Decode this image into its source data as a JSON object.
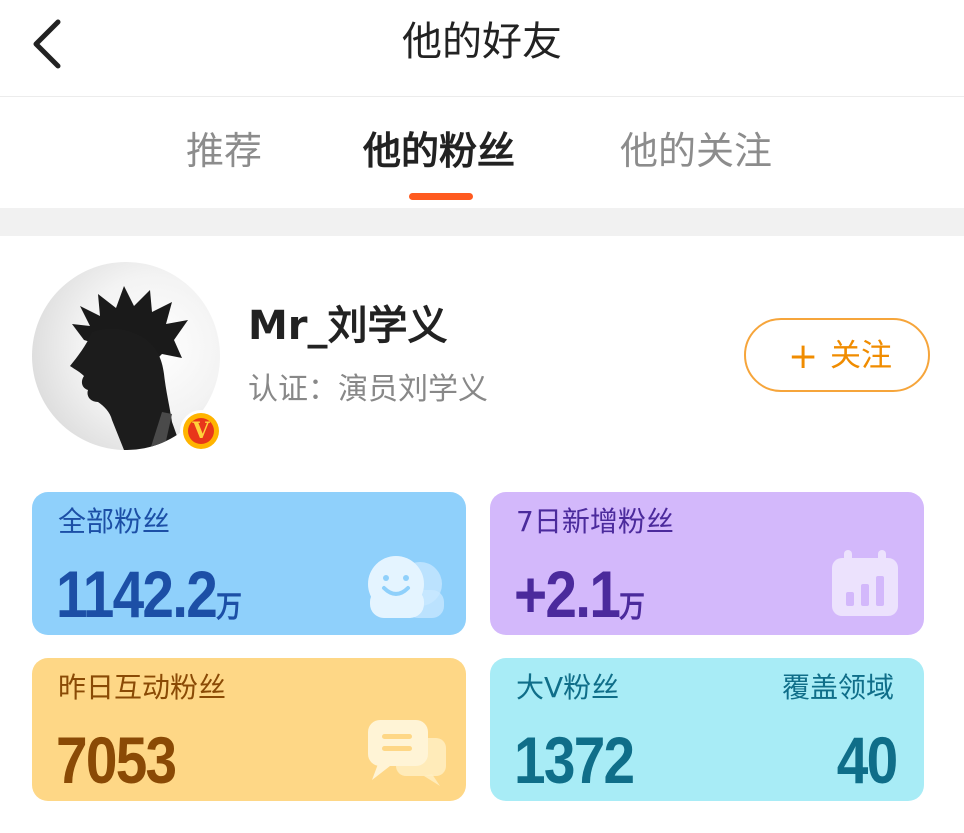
{
  "header": {
    "title": "他的好友",
    "back_icon": "chevron-left-icon"
  },
  "tabs": [
    {
      "label": "推荐",
      "active": false
    },
    {
      "label": "他的粉丝",
      "active": true
    },
    {
      "label": "他的关注",
      "active": false
    }
  ],
  "profile": {
    "username": "Mr_刘学义",
    "verification": "认证：演员刘学义",
    "badge": "V",
    "follow_button": {
      "icon": "plus-icon",
      "plus": "+",
      "label": "关注"
    }
  },
  "stats": {
    "all_fans": {
      "title": "全部粉丝",
      "value": "1142.2",
      "unit": "万",
      "icon": "smiley-users-icon"
    },
    "new_fans_7d": {
      "title": "7日新增粉丝",
      "value": "+2.1",
      "unit": "万",
      "icon": "calendar-chart-icon"
    },
    "interactive_fans": {
      "title": "昨日互动粉丝",
      "value": "7053",
      "icon": "chat-bubbles-icon"
    },
    "bigv_fans": {
      "title": "大V粉丝",
      "value": "1372",
      "coverage_title": "覆盖领域",
      "coverage_value": "40"
    }
  },
  "colors": {
    "accent": "#ff5a1f",
    "follow": "#f08c00",
    "card_all": "#8fd0fb",
    "card_new": "#d3b8fb",
    "card_interactive": "#fed786",
    "card_bigv": "#a8ecf6"
  }
}
